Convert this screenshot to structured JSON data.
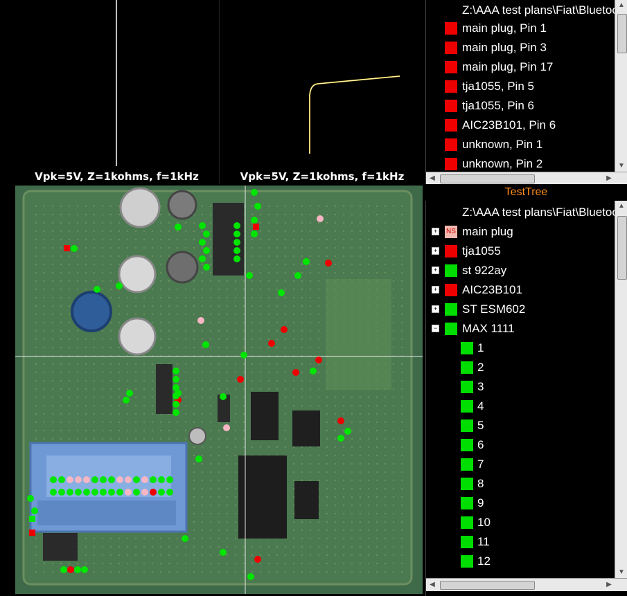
{
  "scopes": [
    {
      "label": "Vpk=5V, Z=1kohms, f=1kHz"
    },
    {
      "label": "Vpk=5V, Z=1kohms, f=1kHz"
    }
  ],
  "top_tree": {
    "root": "Z:\\AAA test plans\\Fiat\\Bluetooth",
    "items": [
      {
        "label": "main plug, Pin 1",
        "status": "fail"
      },
      {
        "label": "main plug, Pin 3",
        "status": "fail"
      },
      {
        "label": "main plug, Pin 17",
        "status": "fail"
      },
      {
        "label": "tja1055, Pin 5",
        "status": "fail"
      },
      {
        "label": "tja1055, Pin 6",
        "status": "fail"
      },
      {
        "label": "AIC23B101, Pin 6",
        "status": "fail"
      },
      {
        "label": "unknown, Pin 1",
        "status": "fail"
      },
      {
        "label": "unknown, Pin 2",
        "status": "fail"
      }
    ]
  },
  "test_tree": {
    "title": "TestTree",
    "root": "Z:\\AAA test plans\\Fiat\\Bluetooth",
    "components": [
      {
        "label": "main plug",
        "status": "ns",
        "badge": "NS",
        "expander": "+"
      },
      {
        "label": "tja1055",
        "status": "fail",
        "expander": "+"
      },
      {
        "label": "st 922ay",
        "status": "pass",
        "expander": "+"
      },
      {
        "label": "AIC23B101",
        "status": "fail",
        "expander": "+"
      },
      {
        "label": "ST ESM602",
        "status": "pass",
        "expander": "+"
      },
      {
        "label": "MAX 1111",
        "status": "pass",
        "expander": "−"
      }
    ],
    "pins": [
      "1",
      "2",
      "3",
      "4",
      "5",
      "6",
      "7",
      "8",
      "9",
      "10",
      "11",
      "12"
    ]
  },
  "colors": {
    "pass": "#00dd00",
    "fail": "#ee0000",
    "ns": "#f4b8b0",
    "accent": "#ff8c1a"
  },
  "icons": {
    "expand": "plus-box-icon",
    "collapse": "minus-box-icon"
  }
}
